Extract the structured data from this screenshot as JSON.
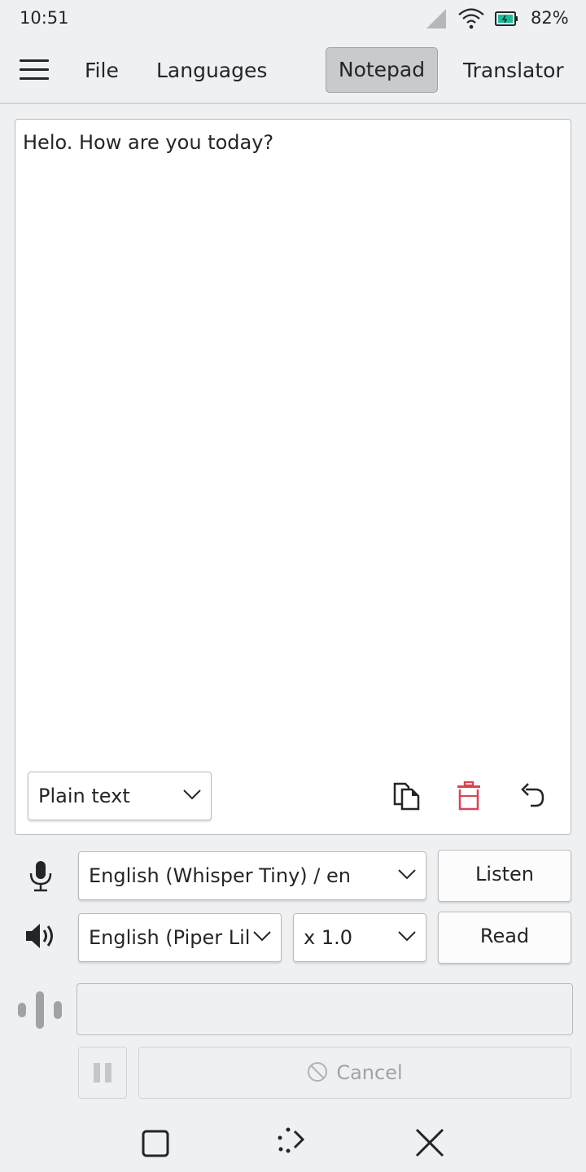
{
  "status_bar": {
    "time": "10:51",
    "battery_percent": "82%",
    "icons": [
      "signal-icon",
      "wifi-icon",
      "battery-icon"
    ]
  },
  "menu": {
    "items": [
      "File",
      "Languages",
      "Notepad",
      "Translator"
    ],
    "active": "Notepad"
  },
  "notepad": {
    "text": "Helo. How are you today?",
    "format": "Plain text",
    "tools": [
      "copy-icon",
      "trash-icon",
      "undo-icon"
    ],
    "trash_color": "#da4453"
  },
  "speech_to_text": {
    "model": "English (Whisper Tiny) / en",
    "button": "Listen"
  },
  "text_to_speech": {
    "voice": "English (Piper Lil",
    "speed": "x 1.0",
    "button": "Read"
  },
  "playback": {
    "cancel_label": "Cancel"
  },
  "nav_bar": {
    "icons": [
      "square-icon",
      "keyboard-hide-icon",
      "close-icon"
    ]
  }
}
